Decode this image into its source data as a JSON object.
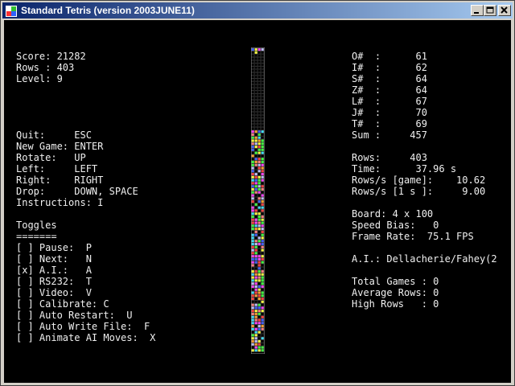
{
  "window": {
    "title": "Standard Tetris (version 2003JUNE11)",
    "controls": {
      "minimize_icon": "minimize-icon",
      "maximize_icon": "maximize-icon",
      "close_icon": "close-icon"
    }
  },
  "left_panel": {
    "score": "Score: 21282",
    "rows": "Rows : 403",
    "level": "Level: 9",
    "keys": [
      "Quit:     ESC",
      "New Game: ENTER",
      "Rotate:   UP",
      "Left:     LEFT",
      "Right:    RIGHT",
      "Drop:     DOWN, SPACE",
      "Instructions: I"
    ],
    "toggles_heading": "Toggles",
    "toggles_underline": "=======",
    "toggles": [
      "[ ] Pause:  P",
      "[ ] Next:   N",
      "[x] A.I.:   A",
      "[ ] RS232:  T",
      "[ ] Video:  V",
      "[ ] Calibrate: C",
      "[ ] Auto Restart:  U",
      "[ ] Auto Write File:  F",
      "[ ] Animate AI Moves:  X"
    ]
  },
  "right_panel": {
    "piece_counts": [
      "O#  :      61",
      "I#  :      62",
      "S#  :      64",
      "Z#  :      64",
      "L#  :      67",
      "J#  :      70",
      "T#  :      69",
      "Sum :     457"
    ],
    "timing": [
      "Rows:     403",
      "Time:      37.96 s",
      "Rows/s [game]:    10.62",
      "Rows/s [1 s ]:     9.00"
    ],
    "config": [
      "Board: 4 x 100",
      "Speed Bias:   0",
      "Frame Rate:  75.1 FPS"
    ],
    "ai": "A.I.: Dellacherie/Fahey(2",
    "summary": [
      "Total Games : 0",
      "Average Rows: 0",
      "High Rows   : 0"
    ]
  },
  "board": {
    "columns": 4,
    "rows": 100,
    "palette": [
      "#ff4040",
      "#40e0ff",
      "#ffff40",
      "#40ff40",
      "#ff40ff",
      "#4060ff",
      "#ffa030",
      "#c0c0ff",
      "#ff8080"
    ],
    "grid_color": "#555555"
  }
}
